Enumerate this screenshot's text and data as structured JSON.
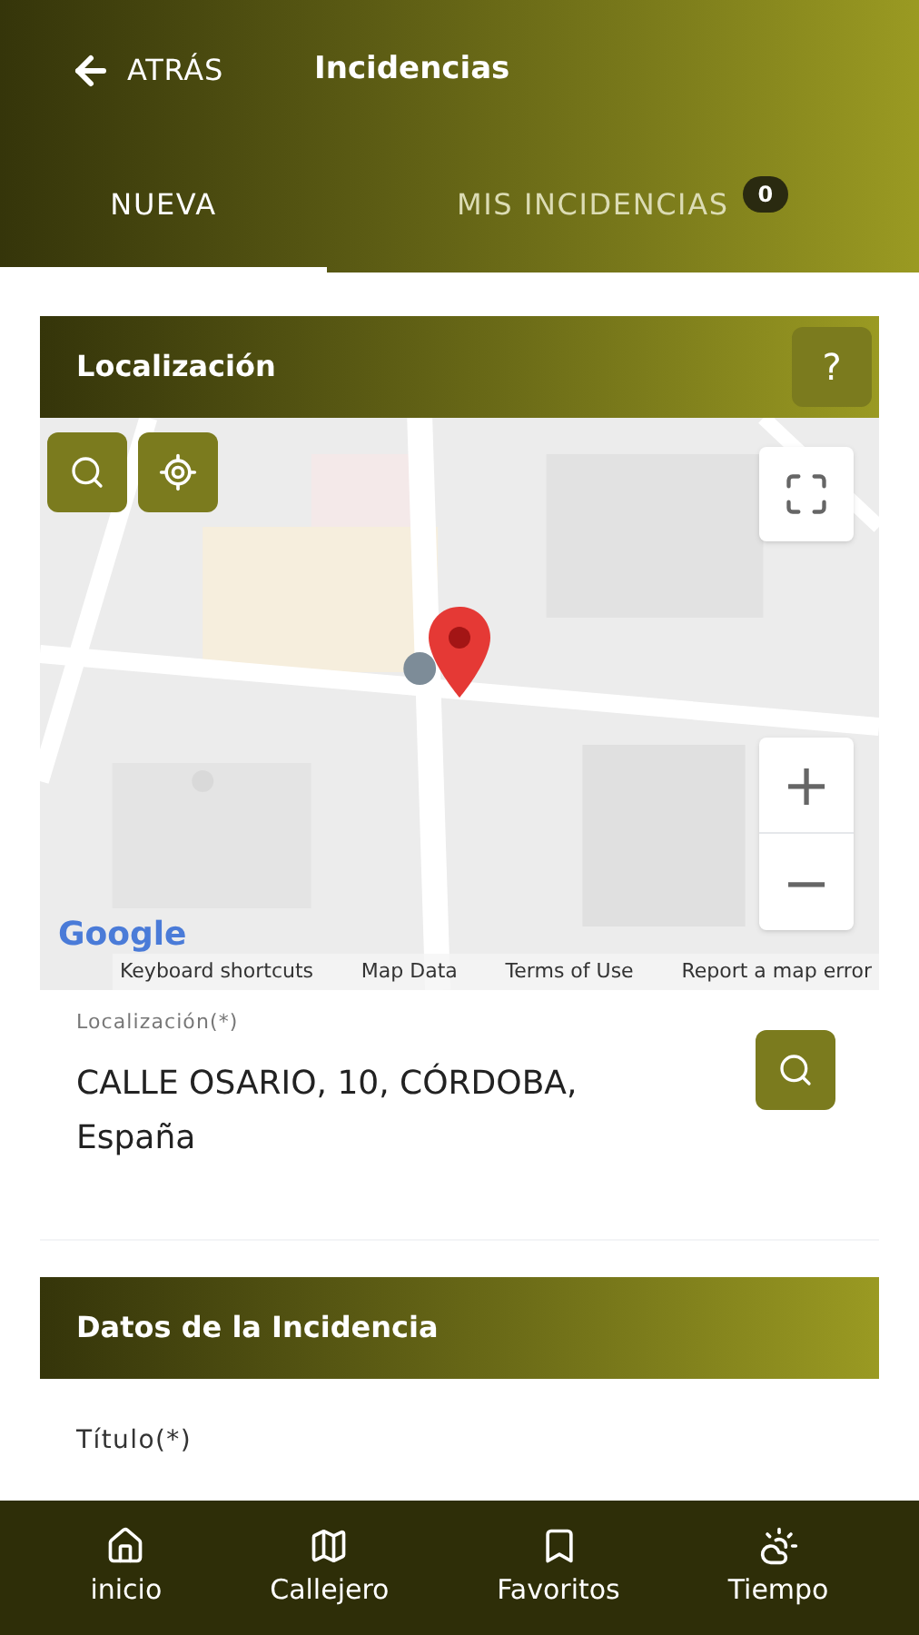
{
  "header": {
    "back": "ATRÁS",
    "title": "Incidencias"
  },
  "tabs": [
    {
      "label": "NUEVA",
      "selected": true
    },
    {
      "label": "MIS INCIDENCIAS",
      "selected": false,
      "badge": "0"
    }
  ],
  "location_section": {
    "title": "Localización",
    "help": "?",
    "map": {
      "logo": "Google",
      "links": [
        "Keyboard shortcuts",
        "Map Data",
        "Terms of Use",
        "Report a map error"
      ],
      "zoom_in": "+",
      "zoom_out": "−"
    },
    "field": {
      "label": "Localización(*)",
      "value": "CALLE OSARIO, 10, CÓRDOBA, España"
    }
  },
  "data_section": {
    "title": "Datos de la Incidencia",
    "field_label": "Título(*)"
  },
  "bottom_nav": [
    {
      "label": "inicio"
    },
    {
      "label": "Callejero"
    },
    {
      "label": "Favoritos"
    },
    {
      "label": "Tiempo"
    }
  ]
}
